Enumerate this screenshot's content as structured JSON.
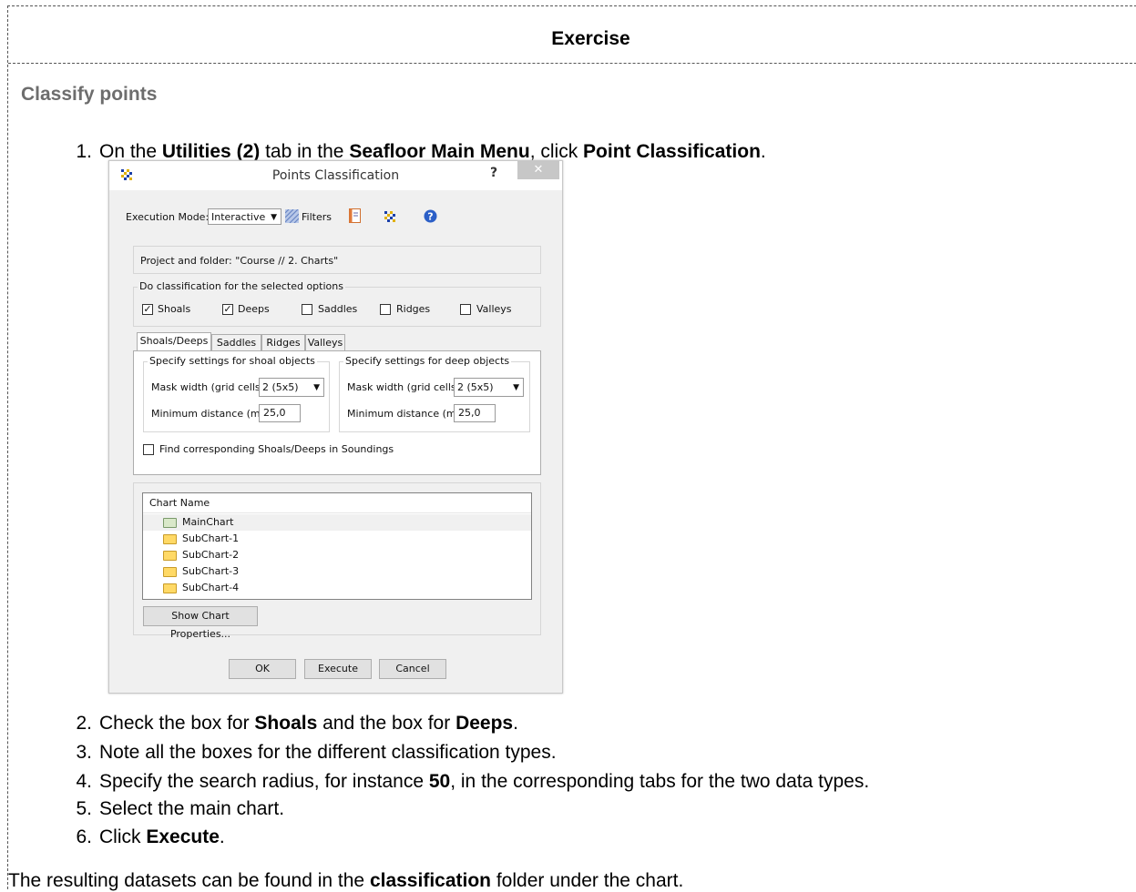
{
  "exercise": {
    "header": "Exercise",
    "section_title": "Classify points",
    "steps": [
      {
        "num": "1.",
        "parts": [
          "On the ",
          "Utilities (2)",
          " tab in the ",
          "Seafloor Main Menu",
          ", click ",
          "Point Classification",
          "."
        ]
      },
      {
        "num": "2.",
        "parts": [
          "Check the box for ",
          "Shoals",
          " and the box for ",
          "Deeps",
          "."
        ]
      },
      {
        "num": "3.",
        "parts": [
          "Note all the boxes for the different classification types."
        ]
      },
      {
        "num": "4.",
        "parts": [
          "Specify the search radius, for instance ",
          "50",
          ", in the corresponding tabs for the two data types."
        ]
      },
      {
        "num": "5.",
        "parts": [
          "Select the main chart."
        ]
      },
      {
        "num": "6.",
        "parts": [
          "Click ",
          "Execute",
          "."
        ]
      }
    ],
    "result": [
      "The resulting datasets can be found in the ",
      "classification",
      " folder under the chart."
    ]
  },
  "dialog": {
    "title": "Points Classification",
    "help": "?",
    "close": "✕",
    "execution_mode_label": "Execution Mode:",
    "execution_mode_value": "Interactive",
    "filters_label": "Filters",
    "project_folder": "Project and folder: \"Course // 2. Charts\"",
    "options_legend": "Do classification for the selected options",
    "options": [
      {
        "label": "Shoals",
        "checked": true
      },
      {
        "label": "Deeps",
        "checked": true
      },
      {
        "label": "Saddles",
        "checked": false
      },
      {
        "label": "Ridges",
        "checked": false
      },
      {
        "label": "Valleys",
        "checked": false
      }
    ],
    "tabs": [
      "Shoals/Deeps",
      "Saddles",
      "Ridges",
      "Valleys"
    ],
    "shoal_legend": "Specify settings for shoal objects",
    "deep_legend": "Specify settings for deep objects",
    "mask_width_label": "Mask width (grid cells):",
    "mask_width_value": "2 (5x5)",
    "min_distance_label": "Minimum distance (m):",
    "min_distance_value": "25,0",
    "find_soundings": "Find corresponding Shoals/Deeps in Soundings",
    "chart_name_header": "Chart Name",
    "charts": [
      "MainChart",
      "SubChart-1",
      "SubChart-2",
      "SubChart-3",
      "SubChart-4"
    ],
    "show_props": "Show Chart Properties...",
    "ok": "OK",
    "execute": "Execute",
    "cancel": "Cancel"
  }
}
